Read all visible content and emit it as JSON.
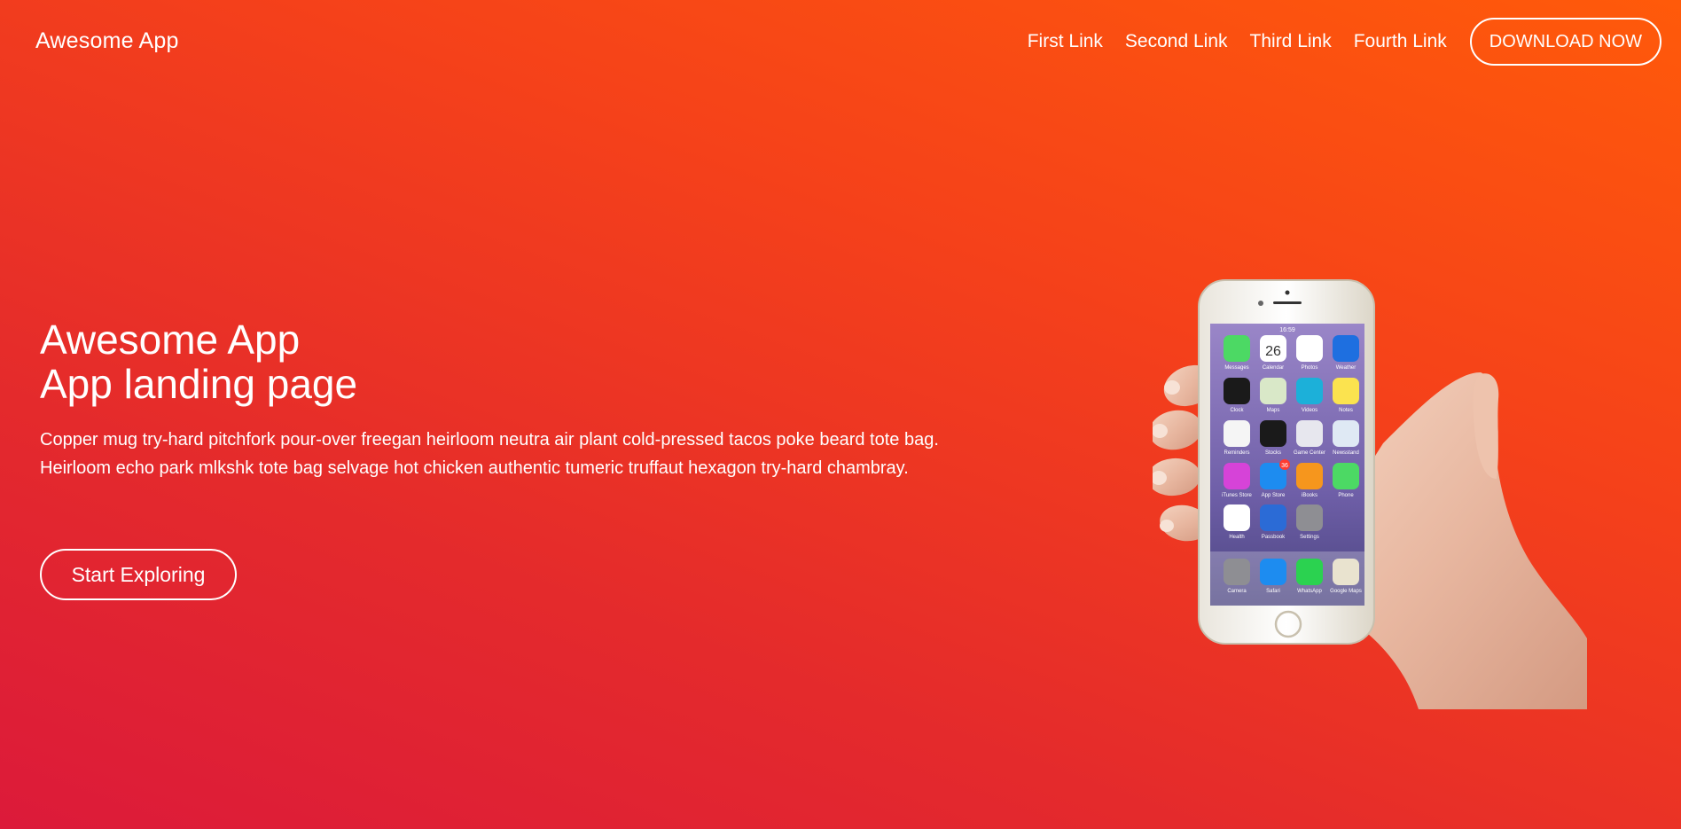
{
  "header": {
    "brand": "Awesome App",
    "nav": [
      {
        "label": "First Link"
      },
      {
        "label": "Second Link"
      },
      {
        "label": "Third Link"
      },
      {
        "label": "Fourth Link"
      }
    ],
    "cta_label": "DOWNLOAD NOW"
  },
  "hero": {
    "title_line1": "Awesome App",
    "title_line2": "App landing page",
    "description": "Copper mug try-hard pitchfork pour-over freegan heirloom neutra air plant cold-pressed tacos poke beard tote bag. Heirloom echo park mlkshk tote bag selvage hot chicken authentic tumeric truffaut hexagon try-hard chambray.",
    "button_label": "Start Exploring"
  },
  "phone": {
    "time": "16:59",
    "calendar_day": "26",
    "app_store_badge": "36",
    "apps": [
      {
        "label": "Messages",
        "color": "#4cd964",
        "icon": "messages-icon"
      },
      {
        "label": "Calendar",
        "color": "#ffffff",
        "icon": "calendar-icon"
      },
      {
        "label": "Photos",
        "color": "#ffffff",
        "icon": "photos-icon"
      },
      {
        "label": "Weather",
        "color": "#1e6fe0",
        "icon": "weather-icon"
      },
      {
        "label": "Clock",
        "color": "#1a1a1a",
        "icon": "clock-icon"
      },
      {
        "label": "Maps",
        "color": "#d9e8c8",
        "icon": "maps-icon"
      },
      {
        "label": "Videos",
        "color": "#1cb0d9",
        "icon": "videos-icon"
      },
      {
        "label": "Notes",
        "color": "#fbe34f",
        "icon": "notes-icon"
      },
      {
        "label": "Reminders",
        "color": "#f5f5f5",
        "icon": "reminders-icon"
      },
      {
        "label": "Stocks",
        "color": "#1a1a1a",
        "icon": "stocks-icon"
      },
      {
        "label": "Game Center",
        "color": "#e7e7ee",
        "icon": "game-center-icon"
      },
      {
        "label": "Newsstand",
        "color": "#dfe9f4",
        "icon": "newsstand-icon"
      },
      {
        "label": "iTunes Store",
        "color": "#d643d8",
        "icon": "itunes-store-icon"
      },
      {
        "label": "App Store",
        "color": "#1d8cf0",
        "icon": "app-store-icon"
      },
      {
        "label": "iBooks",
        "color": "#f6961d",
        "icon": "ibooks-icon"
      },
      {
        "label": "Phone",
        "color": "#4cd964",
        "icon": "phone-icon"
      },
      {
        "label": "Health",
        "color": "#ffffff",
        "icon": "health-icon"
      },
      {
        "label": "Passbook",
        "color": "#2b6bd6",
        "icon": "passbook-icon"
      },
      {
        "label": "Settings",
        "color": "#8e8e93",
        "icon": "settings-icon"
      }
    ],
    "dock": [
      {
        "label": "Camera",
        "color": "#8e8e93",
        "icon": "camera-icon"
      },
      {
        "label": "Safari",
        "color": "#1d8cf0",
        "icon": "safari-icon"
      },
      {
        "label": "WhatsApp",
        "color": "#2bd250",
        "icon": "whatsapp-icon"
      },
      {
        "label": "Google Maps",
        "color": "#e9e3cf",
        "icon": "google-maps-icon"
      }
    ]
  }
}
